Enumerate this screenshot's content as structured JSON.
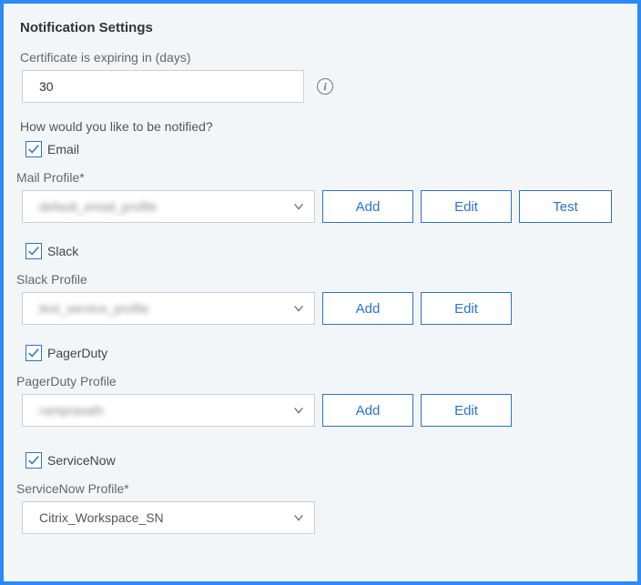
{
  "title": "Notification Settings",
  "expiry": {
    "label": "Certificate is expiring in (days)",
    "value": "30"
  },
  "how_label": "How would you like to be notified?",
  "email": {
    "checked": true,
    "label": "Email",
    "profile_label": "Mail Profile*",
    "selected": "default_email_profile",
    "buttons": {
      "add": "Add",
      "edit": "Edit",
      "test": "Test"
    }
  },
  "slack": {
    "checked": true,
    "label": "Slack",
    "profile_label": "Slack Profile",
    "selected": "test_service_profile",
    "buttons": {
      "add": "Add",
      "edit": "Edit"
    }
  },
  "pagerduty": {
    "checked": true,
    "label": "PagerDuty",
    "profile_label": "PagerDuty Profile",
    "selected": "ramprasath",
    "buttons": {
      "add": "Add",
      "edit": "Edit"
    }
  },
  "servicenow": {
    "checked": true,
    "label": "ServiceNow",
    "profile_label": "ServiceNow Profile*",
    "selected": "Citrix_Workspace_SN"
  }
}
